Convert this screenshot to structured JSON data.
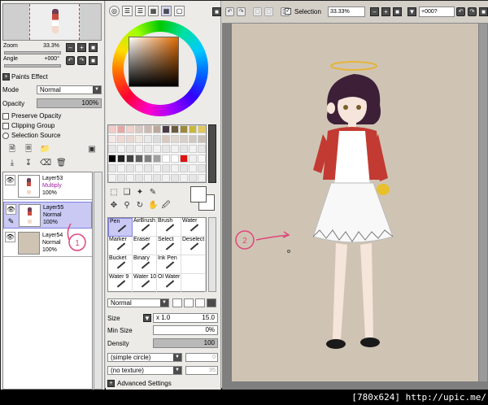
{
  "navigator": {
    "zoom_label": "Zoom",
    "zoom_value": "33.3%",
    "angle_label": "Angle",
    "angle_value": "+000°"
  },
  "paints_effect": {
    "header": "Paints Effect",
    "mode_label": "Mode",
    "mode_value": "Normal",
    "opacity_label": "Opacity",
    "opacity_value": "100%",
    "opacity_fraction": 1.0,
    "preserve_opacity": "Preserve Opacity",
    "clipping_group": "Clipping Group",
    "selection_source": "Selection Source"
  },
  "layers": [
    {
      "name": "Layer53",
      "mode": "Multiply",
      "opacity": "100%",
      "selected": false
    },
    {
      "name": "Layer55",
      "mode": "Normal",
      "opacity": "100%",
      "selected": true
    },
    {
      "name": "Layer54",
      "mode": "Normal",
      "opacity": "100%",
      "selected": false
    }
  ],
  "annotations": {
    "one": "1",
    "two": "2"
  },
  "brushes": [
    {
      "name": "Pen",
      "active": true
    },
    {
      "name": "AirBrush"
    },
    {
      "name": "Brush"
    },
    {
      "name": "Water"
    },
    {
      "name": "Marker"
    },
    {
      "name": "Eraser"
    },
    {
      "name": "Select"
    },
    {
      "name": "Deselect"
    },
    {
      "name": "Bucket"
    },
    {
      "name": "Binary"
    },
    {
      "name": "Ink Pen"
    },
    {
      "name": ""
    },
    {
      "name": "Water 9"
    },
    {
      "name": "Water 10"
    },
    {
      "name": "Ol Water"
    },
    {
      "name": ""
    }
  ],
  "brush_settings": {
    "blend_mode": "Normal",
    "size_label": "Size",
    "size_multiplier": "x 1.0",
    "size_value": "15.0",
    "min_size_label": "Min Size",
    "min_size_value": "0%",
    "density_label": "Density",
    "density_value": "100",
    "shape": "(simple circle)",
    "shape_amount": "0",
    "texture": "(no texture)",
    "texture_amount": "95",
    "advanced": "Advanced Settings"
  },
  "toolbar": {
    "selection_label": "Selection",
    "selection_checked": true,
    "zoom_value": "33.33%",
    "angle_value": "+000?"
  },
  "footer": {
    "text": "[780x624] http://upic.me/"
  },
  "colors": {
    "panel_bg": "#ecebe7",
    "canvas_bg": "#cfc4b4",
    "selected_layer": "#c9c9f4",
    "annotation": "#e0457a"
  }
}
